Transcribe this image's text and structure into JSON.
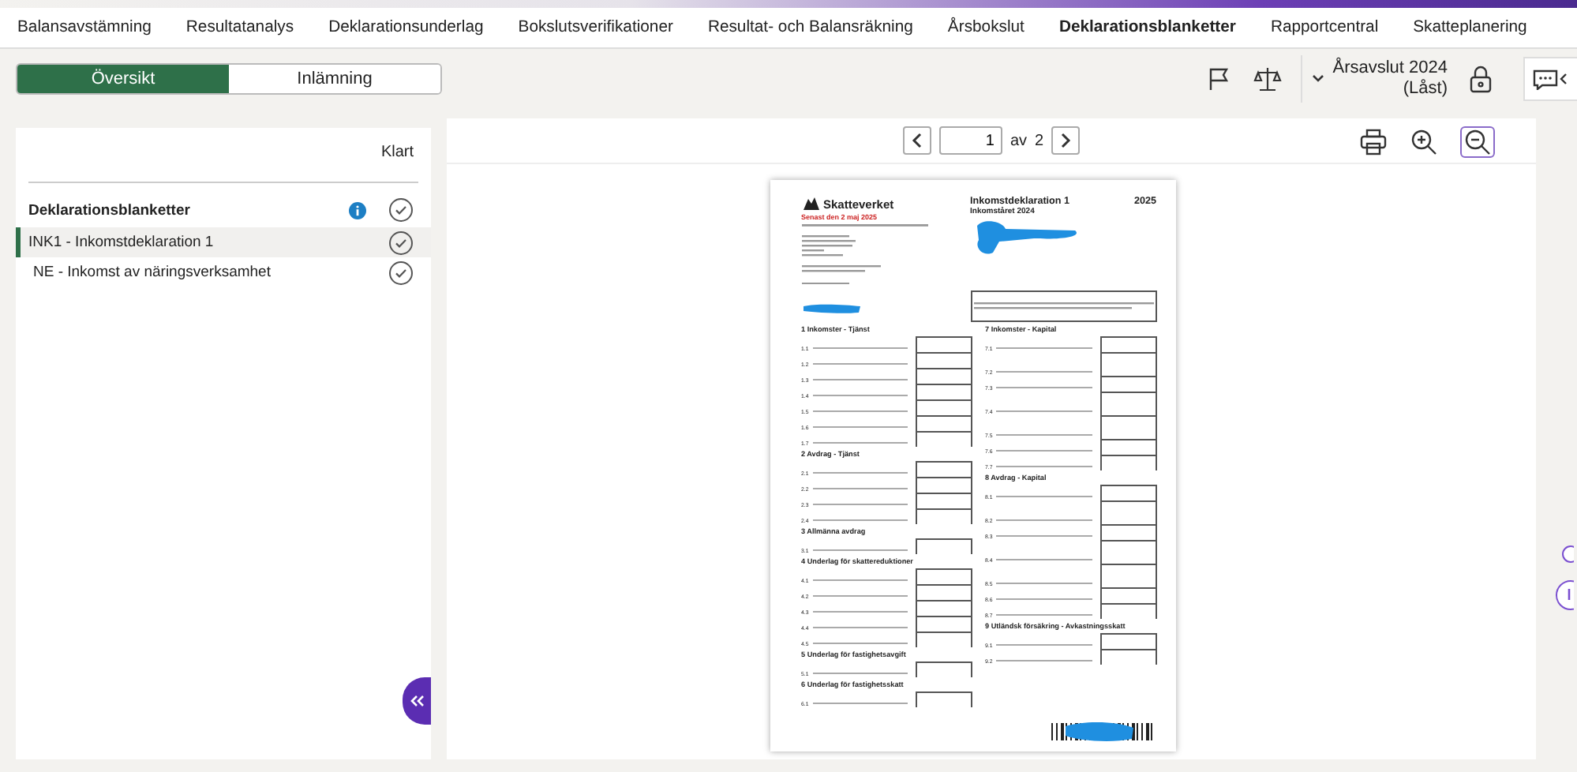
{
  "nav_tabs": [
    {
      "label": "Balansavstämning",
      "selected": false
    },
    {
      "label": "Resultatanalys",
      "selected": false
    },
    {
      "label": "Deklarationsunderlag",
      "selected": false
    },
    {
      "label": "Bokslutsverifikationer",
      "selected": false
    },
    {
      "label": "Resultat- och Balansräkning",
      "selected": false
    },
    {
      "label": "Årsbokslut",
      "selected": false
    },
    {
      "label": "Deklarationsblanketter",
      "selected": true
    },
    {
      "label": "Rapportcentral",
      "selected": false
    },
    {
      "label": "Skatteplanering",
      "selected": false
    }
  ],
  "segments": [
    {
      "label": "Översikt",
      "selected": true
    },
    {
      "label": "Inlämning",
      "selected": false
    }
  ],
  "period": {
    "title": "Årsavslut 2024",
    "status": "(Låst)"
  },
  "sidebar": {
    "column_header": "Klart",
    "group": {
      "title": "Deklarationsblanketter",
      "done": true
    },
    "items": [
      {
        "label": "INK1 - Inkomstdeklaration 1",
        "selected": true,
        "done": true
      },
      {
        "label": "NE - Inkomst av näringsverksamhet",
        "selected": false,
        "done": true
      }
    ]
  },
  "pager": {
    "page": "1",
    "of": "av",
    "total": "2"
  },
  "document": {
    "agency": "Skatteverket",
    "deadline": "Senast den 2 maj 2025",
    "title": "Inkomstdeklaration 1",
    "year": "2025",
    "income_year": "Inkomståret 2024",
    "left_sections": [
      {
        "heading": "1  Inkomster - Tjänst",
        "rows": [
          "1.1",
          "1.2",
          "1.3",
          "1.4",
          "1.5",
          "1.6",
          "1.7"
        ]
      },
      {
        "heading": "2  Avdrag - Tjänst",
        "rows": [
          "2.1",
          "2.2",
          "2.3",
          "2.4"
        ]
      },
      {
        "heading": "3  Allmänna avdrag",
        "rows": [
          "3.1"
        ]
      },
      {
        "heading": "4  Underlag för skattereduktioner",
        "rows": [
          "4.1",
          "4.2",
          "4.3",
          "4.4",
          "4.5"
        ]
      },
      {
        "heading": "5  Underlag för fastighetsavgift",
        "rows": [
          "5.1"
        ]
      },
      {
        "heading": "6  Underlag för fastighetsskatt",
        "rows": [
          "6.1"
        ]
      }
    ],
    "right_sections": [
      {
        "heading": "7  Inkomster - Kapital",
        "rows": [
          "7.1",
          "7.2",
          "7.3",
          "7.4",
          "7.5",
          "7.6",
          "7.7"
        ]
      },
      {
        "heading": "8  Avdrag - Kapital",
        "rows": [
          "8.1",
          "8.2",
          "8.3",
          "8.4",
          "8.5",
          "8.6",
          "8.7"
        ]
      },
      {
        "heading": "9  Utländsk försäkring - Avkastningsskatt",
        "rows": [
          "9.1",
          "9.2"
        ]
      }
    ]
  }
}
